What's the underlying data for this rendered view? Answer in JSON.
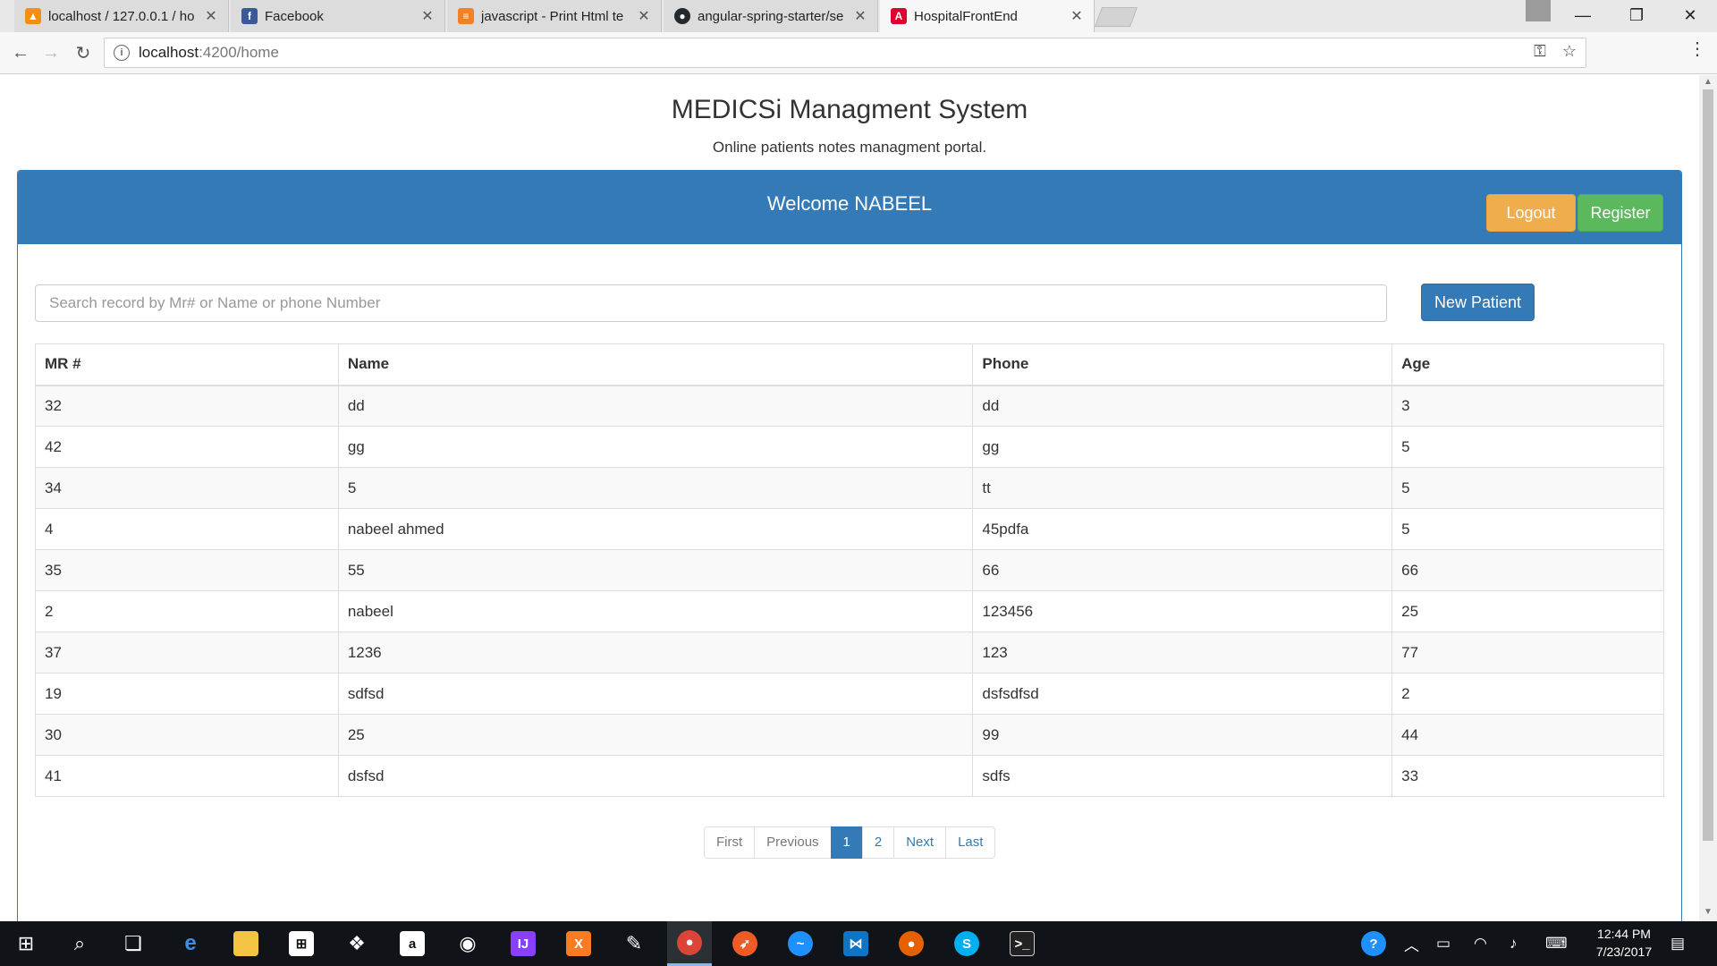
{
  "browser": {
    "tabs": [
      {
        "title": "localhost / 127.0.0.1 / ho",
        "favicon": "phpmyadmin-icon",
        "active": false
      },
      {
        "title": "Facebook",
        "favicon": "facebook-icon",
        "active": false
      },
      {
        "title": "javascript - Print Html te",
        "favicon": "stackoverflow-icon",
        "active": false
      },
      {
        "title": "angular-spring-starter/se",
        "favicon": "github-icon",
        "active": false
      },
      {
        "title": "HospitalFrontEnd",
        "favicon": "angular-icon",
        "active": true
      }
    ],
    "address": {
      "host": "localhost",
      "path": ":4200/home"
    }
  },
  "app": {
    "title": "MEDICSi Managment System",
    "subtitle": "Online patients notes managment portal."
  },
  "panel": {
    "welcome": "Welcome NABEEL",
    "logout_label": "Logout",
    "register_label": "Register"
  },
  "search": {
    "placeholder": "Search record by Mr# or Name or phone Number",
    "value": ""
  },
  "new_patient_label": "New Patient",
  "table": {
    "columns": [
      "MR #",
      "Name",
      "Phone",
      "Age"
    ],
    "rows": [
      [
        "32",
        "dd",
        "dd",
        "3"
      ],
      [
        "42",
        "gg",
        "gg",
        "5"
      ],
      [
        "34",
        "5",
        "tt",
        "5"
      ],
      [
        "4",
        "nabeel ahmed",
        "45pdfa",
        "5"
      ],
      [
        "35",
        "55",
        "66",
        "66"
      ],
      [
        "2",
        "nabeel",
        "123456",
        "25"
      ],
      [
        "37",
        "1236",
        "123",
        "77"
      ],
      [
        "19",
        "sdfsd",
        "dsfsdfsd",
        "2"
      ],
      [
        "30",
        "25",
        "99",
        "44"
      ],
      [
        "41",
        "dsfsd",
        "sdfs",
        "33"
      ]
    ]
  },
  "pagination": {
    "first": "First",
    "previous": "Previous",
    "pages": [
      "1",
      "2"
    ],
    "current": "1",
    "next": "Next",
    "last": "Last"
  },
  "taskbar": {
    "time": "12:44 PM",
    "date": "7/23/2017"
  },
  "colors": {
    "primary": "#337ab7",
    "warning": "#f0ad4e",
    "success": "#5cb85c"
  }
}
